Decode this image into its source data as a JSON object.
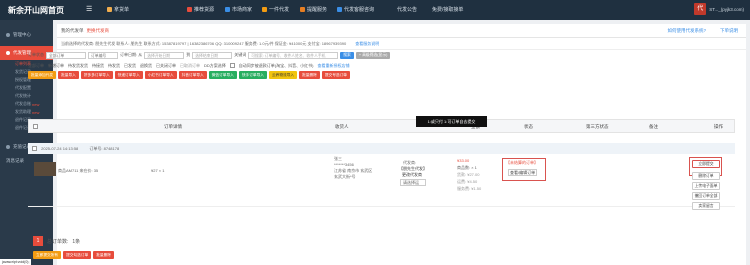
{
  "app": {
    "logo": "新余开山网首页"
  },
  "topnav": [
    {
      "label": "拿货单",
      "color": "#f0ad4e"
    },
    {
      "label": "推荐货源",
      "color": "#e74c3c"
    },
    {
      "label": "市场商家",
      "color": "#3a8ee6"
    },
    {
      "label": "一件代发",
      "color": "#f39c12"
    },
    {
      "label": "提醒服务",
      "color": "#e67e22"
    },
    {
      "label": "代发客服咨询",
      "color": "#3a8ee6"
    },
    {
      "label": "代发公告",
      "color": "#3a8ee6"
    },
    {
      "label": "免费/接取接单",
      "color": "#3a8ee6"
    }
  ],
  "user": {
    "avatar": "代",
    "name": "ST..._(pyjk3.com)"
  },
  "sidebar": {
    "items": [
      {
        "label": "管理中心"
      },
      {
        "label": "代发管理"
      }
    ],
    "subitems": [
      {
        "label": "订单列表",
        "new": ""
      },
      {
        "label": "发货记录",
        "new": ""
      },
      {
        "label": "授权管理",
        "new": ""
      },
      {
        "label": "代发配置",
        "new": ""
      },
      {
        "label": "代发统计",
        "new": ""
      },
      {
        "label": "代发总账",
        "new": "new"
      },
      {
        "label": "发货助理",
        "new": "new"
      },
      {
        "label": "退件记录",
        "new": "new"
      },
      {
        "label": "退件记录",
        "new": "new"
      }
    ],
    "items2": [
      {
        "label": "充值记录"
      },
      {
        "label": "消息记录"
      }
    ]
  },
  "header": {
    "title": "我的代发单",
    "red_link": "更换代发商",
    "link1": "如何使用代发系统?",
    "link2": "下单说明"
  },
  "info": {
    "text": "当前选择的代发商: 朋先生代发  联系人: 朋先生  联系方式: 15387819797 | 16382386706  QQ: 310009247  服务费: 1.0元/件  保证金: ¥41000元  支付宝: 18967939390",
    "link": "查看服务说明"
  },
  "filter": {
    "label1": "订单状态",
    "sel1": "全部订单",
    "sel2": "订单编号",
    "label2": "订单日期: 从",
    "date_from": "选择开始日期",
    "label3": "到",
    "date_to": "选择结束日期",
    "label4": "关键词",
    "kw_ph": "可搜索: 订单编号、收件人姓名、收件人手机",
    "search": "搜索",
    "adv": "+ 高级筛选(显示)"
  },
  "row2": {
    "items": [
      "全部订单",
      "新增订单",
      "待发货发货",
      "待接货",
      "待发货",
      "已发货",
      "退换货",
      "已关闭订单",
      "已取消订单"
    ],
    "dd": "DD方案选择",
    "cb1": "自动同步被退款订单(淘宝、抖音、小红书)",
    "cb_link": "查看重新授权店铺"
  },
  "buttons": [
    {
      "label": "批量添加代发",
      "cls": "b-o"
    },
    {
      "label": "批量导入",
      "cls": "b-r"
    },
    {
      "label": "拼多多订单导入",
      "cls": "b-r"
    },
    {
      "label": "快递订单导入",
      "cls": "b-r"
    },
    {
      "label": "小红书订单导入",
      "cls": "b-r"
    },
    {
      "label": "抖音订单导入",
      "cls": "b-r"
    },
    {
      "label": "微信订单导入",
      "cls": "b-g"
    },
    {
      "label": "快手订单导入",
      "cls": "b-g"
    },
    {
      "label": "云养物流导入",
      "cls": "b-y"
    },
    {
      "label": "批量删除",
      "cls": "b-r"
    },
    {
      "label": "提交号选订单",
      "cls": "b-r"
    }
  ],
  "tooltip": "1:或只付 1:可订单自去提交",
  "table": {
    "h_detail": "订单详情",
    "h_receiver": "收货人",
    "h_amount": "金额",
    "h_status": "状态",
    "h_third": "第三方状态",
    "h_remark": "备注",
    "h_op": "操作"
  },
  "order": {
    "date": "2025-07-24 14:13:58",
    "no": "订单号: 8748178",
    "product": "商品AM711  来在价: 35",
    "qty": "¥27 × 1",
    "recv_name": "张三",
    "recv_phone": "*******3456",
    "recv_addr": "江苏省 南京市 玄武区",
    "recv_addr2": "玄武大街*号",
    "dist_title": "代发商:",
    "dist_name": "【朋先生代发】",
    "dist_change": "更改代发商",
    "dist_select": "请选择运",
    "amt1": "¥33.00",
    "amt2": "商品数: × 1",
    "amt3": "货款: ¥27.00",
    "amt4": "运费: ¥4.50",
    "amt5": "服务费: ¥1.50",
    "status1": "【未结算的订单】",
    "status2": "查看/编辑订单",
    "ops": [
      "立即提交",
      "删除订单",
      "上传电子面单",
      "撤回订单全部",
      "卖家留言"
    ]
  },
  "pager": {
    "page": "1",
    "total_label": "总订单数:",
    "total": "1条"
  },
  "bottom": [
    {
      "label": "立即提交所有",
      "cls": "b-o"
    },
    {
      "label": "提交勾选订单",
      "cls": "b-r"
    },
    {
      "label": "批量删除",
      "cls": "b-r"
    }
  ],
  "statusbar": "javascript:void(0);"
}
